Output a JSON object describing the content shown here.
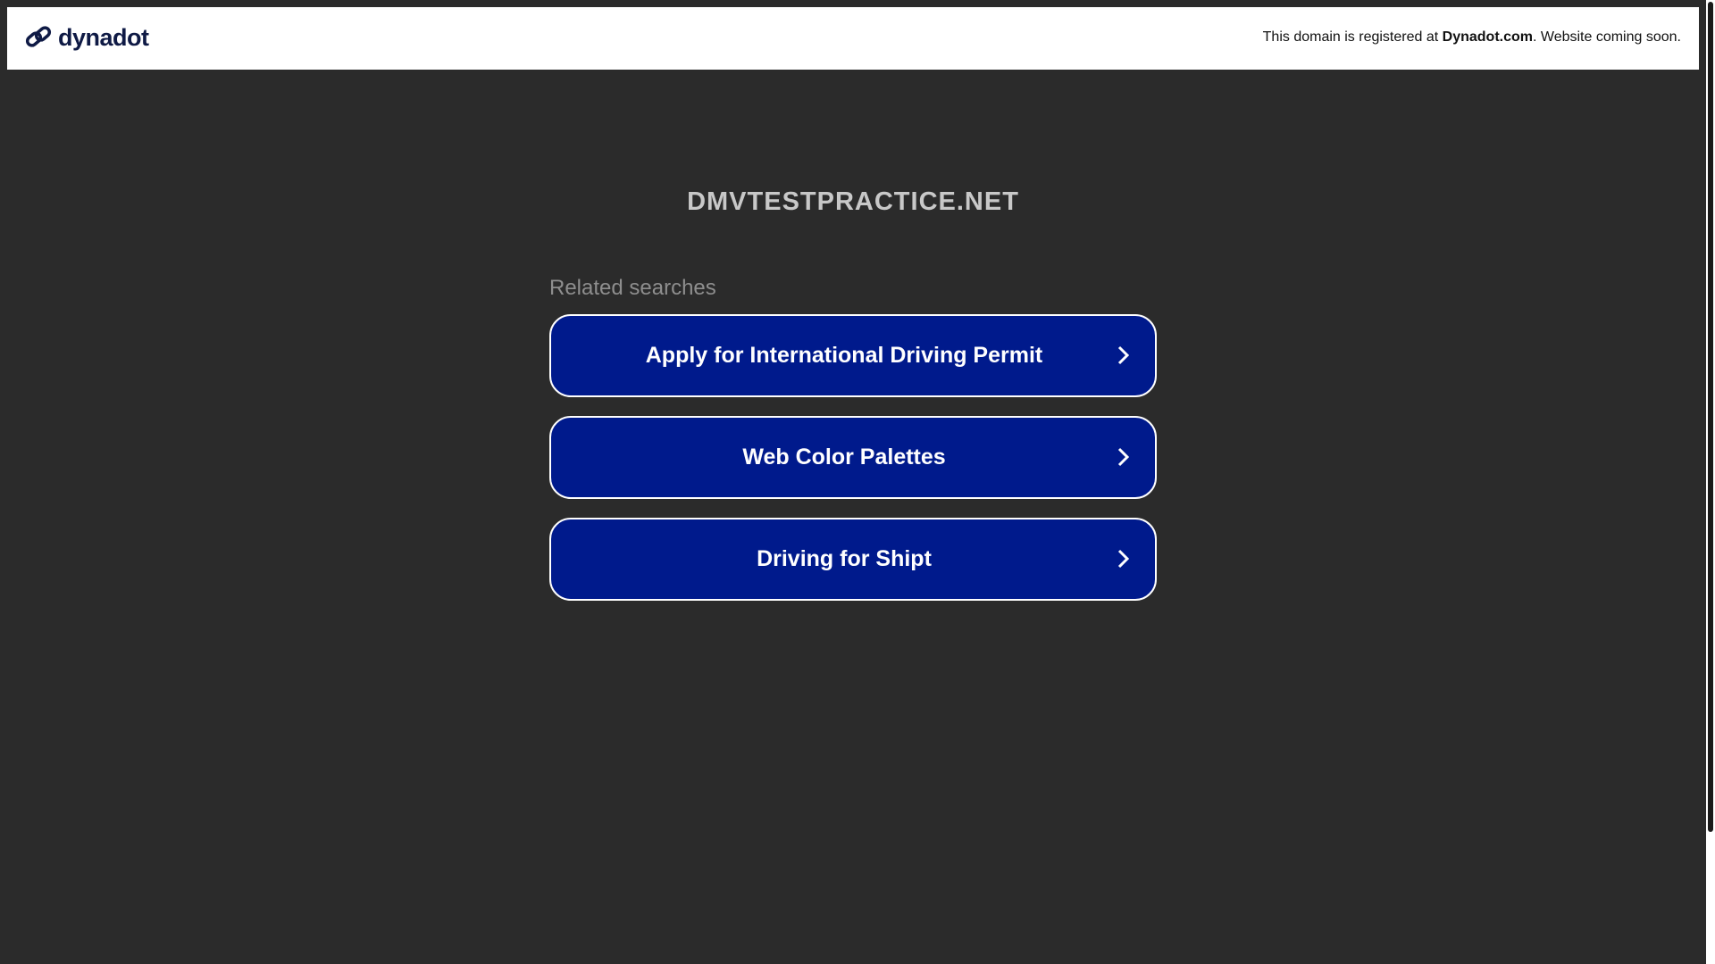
{
  "header": {
    "logo_text": "dynadot",
    "notice_prefix": "This domain is registered at ",
    "notice_link": "Dynadot.com",
    "notice_suffix": ". Website coming soon."
  },
  "main": {
    "domain_title": "DMVTESTPRACTICE.NET",
    "related_label": "Related searches",
    "searches": [
      {
        "label": "Apply for International Driving Permit"
      },
      {
        "label": "Web Color Palettes"
      },
      {
        "label": "Driving for Shipt"
      }
    ]
  },
  "colors": {
    "button_bg": "#001a8c",
    "page_bg": "#2b2b2b",
    "brand": "#0f1a45"
  }
}
